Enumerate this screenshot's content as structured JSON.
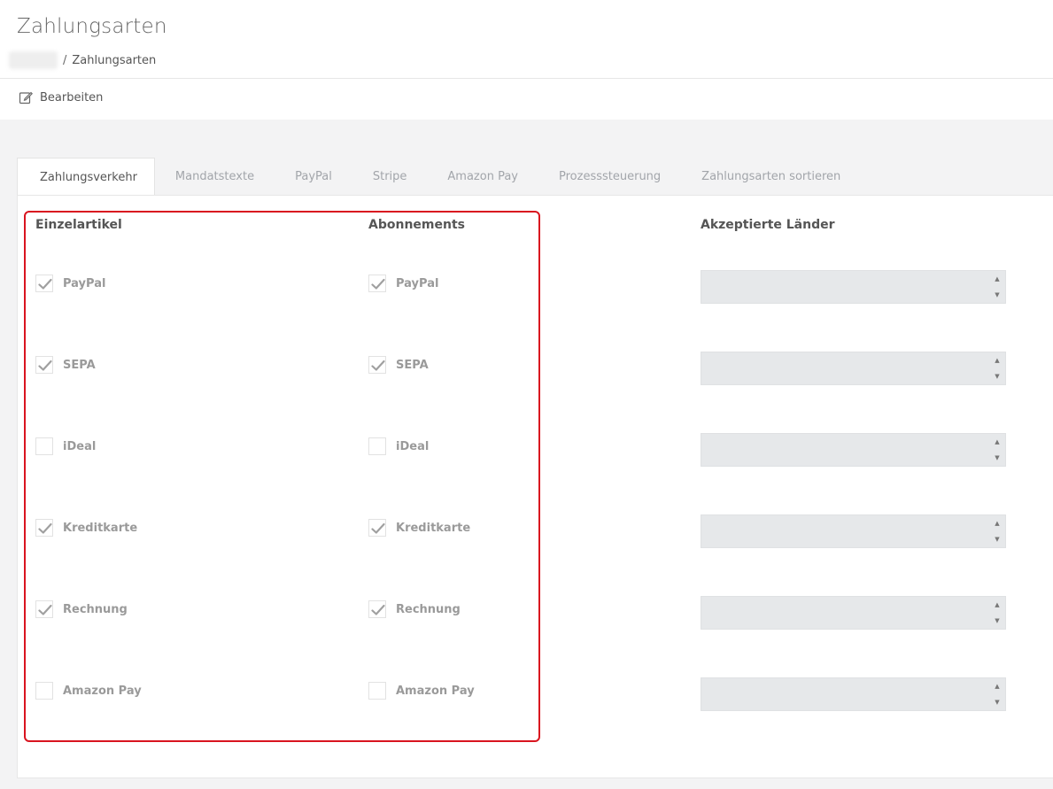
{
  "page": {
    "title": "Zahlungsarten"
  },
  "breadcrumb": {
    "current": "Zahlungsarten",
    "separator": "/"
  },
  "toolbar": {
    "edit_label": "Bearbeiten"
  },
  "tabs": [
    {
      "label": "Zahlungsverkehr",
      "active": true
    },
    {
      "label": "Mandatstexte",
      "active": false
    },
    {
      "label": "PayPal",
      "active": false
    },
    {
      "label": "Stripe",
      "active": false
    },
    {
      "label": "Amazon Pay",
      "active": false
    },
    {
      "label": "Prozesssteuerung",
      "active": false
    },
    {
      "label": "Zahlungsarten sortieren",
      "active": false
    }
  ],
  "columns": {
    "einzel": "Einzelartikel",
    "abo": "Abonnements",
    "countries": "Akzeptierte Länder"
  },
  "methods": [
    {
      "label": "PayPal",
      "einzel": true,
      "abo": true
    },
    {
      "label": "SEPA",
      "einzel": true,
      "abo": true
    },
    {
      "label": "iDeal",
      "einzel": false,
      "abo": false
    },
    {
      "label": "Kreditkarte",
      "einzel": true,
      "abo": true
    },
    {
      "label": "Rechnung",
      "einzel": true,
      "abo": true
    },
    {
      "label": "Amazon Pay",
      "einzel": false,
      "abo": false
    }
  ],
  "colors": {
    "highlight": "#d9141f",
    "checkmark": "#a0a0a0"
  },
  "icons": {
    "edit": "edit-icon",
    "check": "check-icon",
    "spinner_up": "chevron-up-icon",
    "spinner_down": "chevron-down-icon"
  }
}
